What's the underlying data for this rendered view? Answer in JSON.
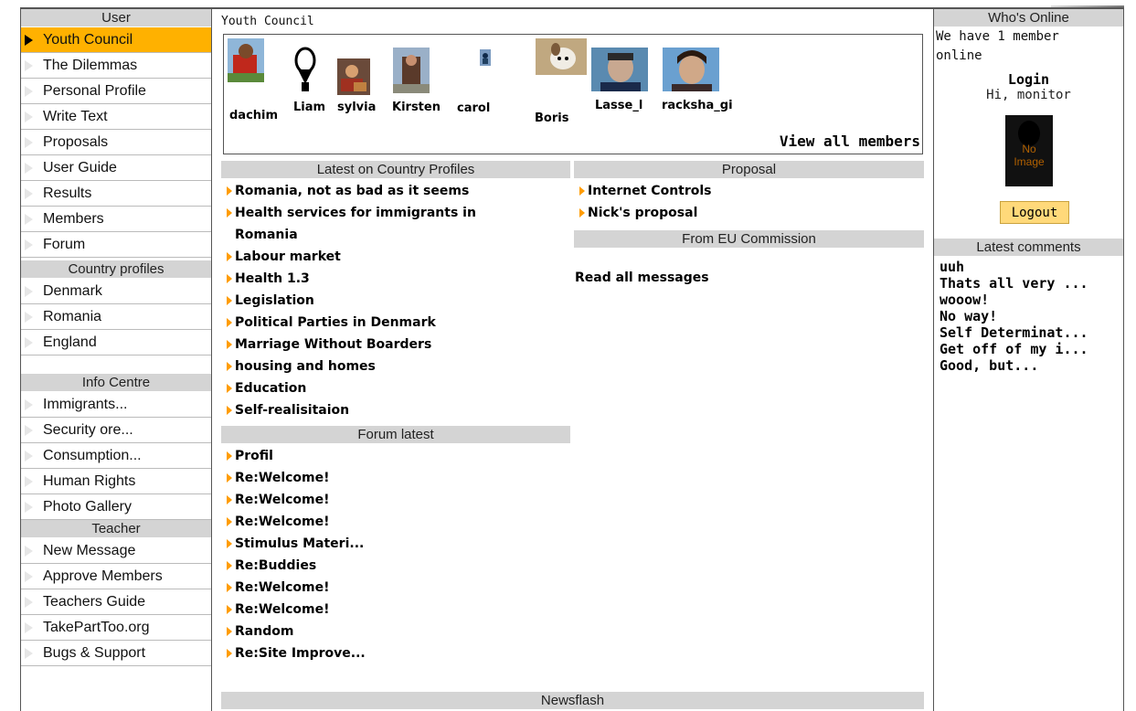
{
  "left_nav": {
    "user_head": "User",
    "user_items": [
      {
        "label": "Youth Council",
        "active": true
      },
      {
        "label": "The Dilemmas"
      },
      {
        "label": "Personal Profile"
      },
      {
        "label": "Write Text"
      },
      {
        "label": "Proposals"
      },
      {
        "label": "User Guide"
      },
      {
        "label": "Results"
      },
      {
        "label": "Members"
      },
      {
        "label": "Forum"
      }
    ],
    "country_head": "Country profiles",
    "country_items": [
      {
        "label": "Denmark"
      },
      {
        "label": "Romania"
      },
      {
        "label": "England"
      }
    ],
    "info_head": "Info Centre",
    "info_items": [
      {
        "label": "Immigrants..."
      },
      {
        "label": "Security ore..."
      },
      {
        "label": "Consumption..."
      },
      {
        "label": "Human Rights"
      },
      {
        "label": "Photo Gallery"
      }
    ],
    "teacher_head": "Teacher",
    "teacher_items": [
      {
        "label": "New Message"
      },
      {
        "label": "Approve Members"
      },
      {
        "label": "Teachers Guide"
      },
      {
        "label": "TakePartToo.org"
      },
      {
        "label": "Bugs & Support"
      }
    ]
  },
  "main": {
    "breadcrumb": "Youth Council",
    "members": [
      "dachim",
      "Liam",
      "sylvia",
      "Kirsten",
      "carol",
      "Boris",
      "Lasse_l",
      "racksha_gi"
    ],
    "view_all": "View all members",
    "country_profiles_head": "Latest on Country Profiles",
    "country_profiles": [
      "Romania, not as bad as it seems",
      "Health services for immigrants in",
      "Romania",
      "Labour market",
      "Health 1.3",
      "Legislation",
      "Political Parties in Denmark",
      "Marriage Without Boarders",
      "housing and homes",
      "Education",
      "Self-realisitaion"
    ],
    "forum_head": "Forum latest",
    "forum_items": [
      "Profil",
      "Re:Welcome!",
      "Re:Welcome!",
      "Re:Welcome!",
      "Stimulus Materi...",
      "Re:Buddies",
      "Re:Welcome!",
      "Re:Welcome!",
      "Random",
      "Re:Site Improve..."
    ],
    "proposal_head": "Proposal",
    "proposals": [
      "Internet Controls",
      "Nick's proposal"
    ],
    "eu_head": "From EU Commission",
    "read_all": "Read all messages",
    "newsflash_head": "Newsflash"
  },
  "right": {
    "online_head": "Who's Online",
    "online_text_1": "We have 1 member",
    "online_text_2": "online",
    "login_title": "Login",
    "greeting": "Hi, monitor",
    "noimage_1": "No",
    "noimage_2": "Image",
    "logout": "Logout",
    "comments_head": "Latest comments",
    "comments": [
      "uuh",
      "Thats all very ...",
      "wooow!",
      "No way!",
      "Self Determinat...",
      "Get off of my i...",
      "Good, but..."
    ]
  },
  "colors": {
    "accent": "#ffb100",
    "header_gray": "#d4d4d4",
    "arrow": "#ff9c00"
  }
}
